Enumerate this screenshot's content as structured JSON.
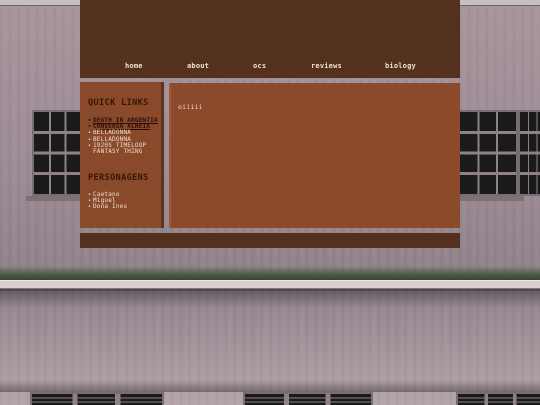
{
  "nav": {
    "items": [
      {
        "label": "home"
      },
      {
        "label": "about"
      },
      {
        "label": "ocs"
      },
      {
        "label": "reviews"
      },
      {
        "label": "biology"
      }
    ]
  },
  "sidebar": {
    "quick_links": {
      "heading": "QUICK LINKS",
      "items": [
        {
          "label": "DEATH IN ARGENTIA",
          "linked": true
        },
        {
          "label": "CONVERSA ALHEIA",
          "linked": true
        },
        {
          "label": "BELLADONNA",
          "linked": false
        },
        {
          "label": "BELLADONNA",
          "linked": false
        },
        {
          "label": "1920S TIMELOOP FANTASY THING",
          "linked": false
        }
      ]
    },
    "personagens": {
      "heading": "PERSONAGENS",
      "items": [
        {
          "label": "Caetano"
        },
        {
          "label": "Miguel"
        },
        {
          "label": "Dona Ines"
        }
      ]
    }
  },
  "main": {
    "text": "oiiiii"
  },
  "colors": {
    "header_bg": "#54301f",
    "panel_bg": "#894a2c",
    "heading_text": "#391405",
    "body_text": "#f2dccb"
  }
}
